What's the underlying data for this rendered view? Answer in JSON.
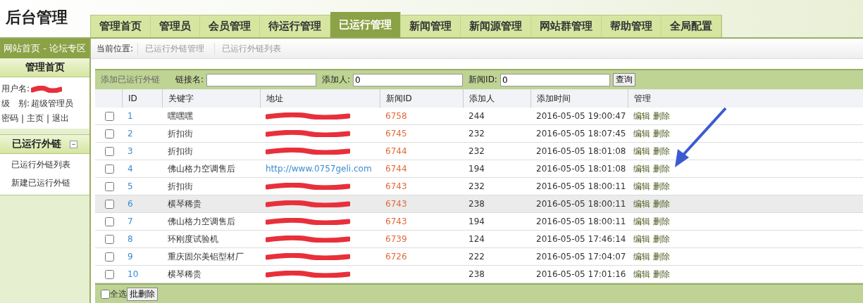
{
  "header": {
    "title": "后台管理"
  },
  "tabs": [
    {
      "label": "管理首页",
      "selected": false
    },
    {
      "label": "管理员",
      "selected": false
    },
    {
      "label": "会员管理",
      "selected": false
    },
    {
      "label": "待运行管理",
      "selected": false
    },
    {
      "label": "已运行管理",
      "selected": true
    },
    {
      "label": "新闻管理",
      "selected": false
    },
    {
      "label": "新闻源管理",
      "selected": false
    },
    {
      "label": "网站群管理",
      "selected": false
    },
    {
      "label": "帮助管理",
      "selected": false
    },
    {
      "label": "全局配置",
      "selected": false
    }
  ],
  "sidebar": {
    "site_link": "网站首页 - 论坛专区",
    "home_title": "管理首页",
    "user": {
      "username_label": "用户名:",
      "username_redacted": true,
      "level_label": "级　别:",
      "level": "超级管理员"
    },
    "user_links": [
      "密码",
      "主页",
      "退出"
    ],
    "user_link_separator": "|",
    "section": {
      "title": "已运行外链",
      "expanded": true,
      "toggle": "−",
      "items": [
        "已运行外链列表",
        "新建已运行外链"
      ]
    }
  },
  "breadcrumb": {
    "label": "当前位置:",
    "items": [
      "已运行外链管理",
      "已运行外链列表"
    ]
  },
  "filter": {
    "title": "添加已运行外链",
    "fields": [
      {
        "label": "链接名:"
      },
      {
        "label": "添加人:",
        "value": "0"
      },
      {
        "label": "新闻ID:",
        "value": "0"
      }
    ],
    "button": "查询"
  },
  "table": {
    "columns": [
      "ID",
      "关键字",
      "地址",
      "新闻ID",
      "添加人",
      "添加时间",
      "管理"
    ],
    "rows": [
      {
        "checked": false,
        "hovered": false,
        "id": "1",
        "keyword": "嘿嘿嘿",
        "address_redacted": true,
        "news_id": "6758",
        "adder": "244",
        "time": "2016-05-05 19:00:47",
        "actions": [
          "编辑",
          "删除"
        ]
      },
      {
        "checked": false,
        "hovered": false,
        "id": "2",
        "keyword": "折扣街",
        "address_redacted": true,
        "news_id": "6745",
        "adder": "232",
        "time": "2016-05-05 18:07:45",
        "actions": [
          "编辑",
          "删除"
        ]
      },
      {
        "checked": false,
        "hovered": false,
        "id": "3",
        "keyword": "折扣街",
        "address_redacted": true,
        "news_id": "6744",
        "adder": "232",
        "time": "2016-05-05 18:01:08",
        "actions": [
          "编辑",
          "删除"
        ]
      },
      {
        "checked": false,
        "hovered": false,
        "id": "4",
        "keyword": "佛山格力空调售后",
        "address": "http://www.0757geli.com",
        "address_redacted": false,
        "news_id": "6744",
        "adder": "194",
        "time": "2016-05-05 18:01:08",
        "actions": [
          "编辑",
          "删除"
        ]
      },
      {
        "checked": false,
        "hovered": false,
        "id": "5",
        "keyword": "折扣街",
        "address_redacted": true,
        "news_id": "6743",
        "adder": "232",
        "time": "2016-05-05 18:00:11",
        "actions": [
          "编辑",
          "删除"
        ]
      },
      {
        "checked": false,
        "hovered": true,
        "id": "6",
        "keyword": "横琴稀贵",
        "address_redacted": true,
        "news_id": "6743",
        "adder": "238",
        "time": "2016-05-05 18:00:11",
        "actions": [
          "编辑",
          "删除"
        ]
      },
      {
        "checked": false,
        "hovered": false,
        "id": "7",
        "keyword": "佛山格力空调售后",
        "address_redacted": true,
        "news_id": "6743",
        "adder": "194",
        "time": "2016-05-05 18:00:11",
        "actions": [
          "编辑",
          "删除"
        ]
      },
      {
        "checked": false,
        "hovered": false,
        "id": "8",
        "keyword": "环刚度试验机",
        "address_redacted": true,
        "news_id": "6739",
        "adder": "124",
        "time": "2016-05-05 17:46:14",
        "actions": [
          "编辑",
          "删除"
        ]
      },
      {
        "checked": false,
        "hovered": false,
        "id": "9",
        "keyword": "重庆固尔美铝型材厂",
        "address_redacted": true,
        "news_id": "6726",
        "adder": "222",
        "time": "2016-05-05 17:04:07",
        "actions": [
          "编辑",
          "删除"
        ]
      },
      {
        "checked": false,
        "hovered": false,
        "id": "10",
        "keyword": "横琴稀贵",
        "address_redacted": true,
        "adder": "238",
        "time": "2016-05-05 17:01:16",
        "actions": [
          "编辑",
          "删除"
        ]
      }
    ]
  },
  "footer": {
    "select_all": {
      "label": "全选",
      "checked": false
    },
    "batch_delete": "批删除"
  },
  "annotation": {
    "kind": "arrow"
  }
}
